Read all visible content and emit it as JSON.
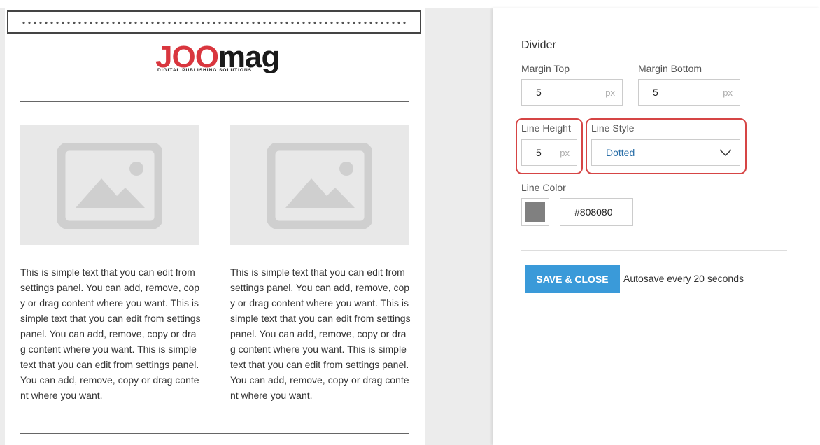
{
  "logo": {
    "brand_left": "JOO",
    "brand_right": "mag",
    "tagline": "DIGITAL PUBLISHING SOLUTIONS"
  },
  "content": {
    "columns": [
      {
        "text": "This is simple text that you can edit from settings panel. You can add, remove, copy or drag content where you want. This is simple text that you can edit from settings panel. You can add, remove, copy or drag content where you want. This is simple text that you can edit from settings panel. You can add, remove, copy or drag content where you want."
      },
      {
        "text": "This is simple text that you can edit from settings panel. You can add, remove, copy or drag content where you want. This is simple text that you can edit from settings panel. You can add, remove, copy or drag content where you want. This is simple text that you can edit from settings panel. You can add, remove, copy or drag content where you want."
      }
    ]
  },
  "panel": {
    "title": "Divider",
    "margin_top": {
      "label": "Margin Top",
      "value": "5",
      "unit": "px"
    },
    "margin_bottom": {
      "label": "Margin Bottom",
      "value": "5",
      "unit": "px"
    },
    "line_height": {
      "label": "Line Height",
      "value": "5",
      "unit": "px"
    },
    "line_style": {
      "label": "Line Style",
      "value": "Dotted"
    },
    "line_color": {
      "label": "Line Color",
      "value": "#808080"
    },
    "save_label": "SAVE & CLOSE",
    "autosave_text": "Autosave every 20 seconds"
  },
  "colors": {
    "accent": "#3a9ad9",
    "highlight": "#d64545",
    "brand_red": "#d9363e",
    "swatch": "#808080"
  },
  "icons": {
    "image_placeholder": "image-placeholder-icon",
    "dropdown": "chevron-down-icon"
  }
}
